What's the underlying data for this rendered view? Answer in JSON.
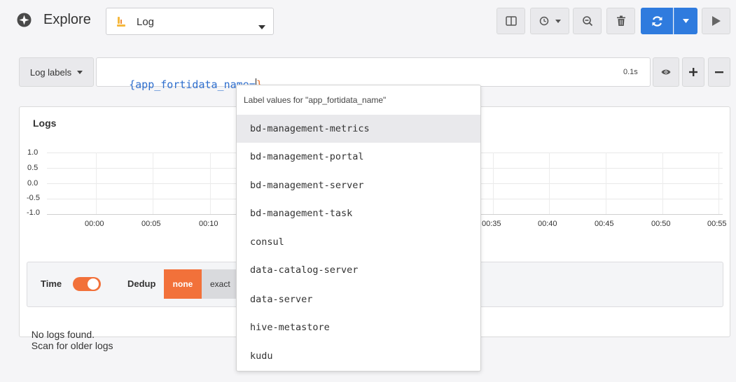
{
  "header": {
    "title": "Explore",
    "datasource": "Log"
  },
  "query": {
    "log_labels_button": "Log labels",
    "expression_open": "{app_fortidata_name=",
    "expression_close": "}",
    "duration": "0.1s"
  },
  "logs_panel": {
    "title": "Logs",
    "y_ticks": [
      "1.0",
      "0.5",
      "0.0",
      "-0.5",
      "-1.0"
    ],
    "x_ticks": [
      "00:00",
      "00:05",
      "00:10",
      "00:35",
      "00:40",
      "00:45",
      "00:50",
      "00:55"
    ],
    "time_label": "Time",
    "time_toggle_on": true,
    "dedup_label": "Dedup",
    "dedup_options": [
      "none",
      "exact"
    ],
    "dedup_selected": "none",
    "status_text": "No logs found.",
    "scan_link": "Scan for older logs"
  },
  "autocomplete": {
    "title": "Label values for \"app_fortidata_name\"",
    "items": [
      "bd-management-metrics",
      "bd-management-portal",
      "bd-management-server",
      "bd-management-task",
      "consul",
      "data-catalog-server",
      "data-server",
      "hive-metastore",
      "kudu"
    ],
    "selected_index": 0
  },
  "colors": {
    "accent_blue": "#2f7bde",
    "accent_orange": "#f2713a",
    "query_text": "#2f6fce",
    "brace_orange": "#e8712b"
  },
  "icons": [
    "compass-icon",
    "datasource-log-icon",
    "caret-down-icon",
    "split-icon",
    "clock-icon",
    "zoom-out-icon",
    "trash-icon",
    "refresh-icon",
    "play-icon",
    "eye-icon",
    "plus-icon",
    "minus-icon"
  ]
}
